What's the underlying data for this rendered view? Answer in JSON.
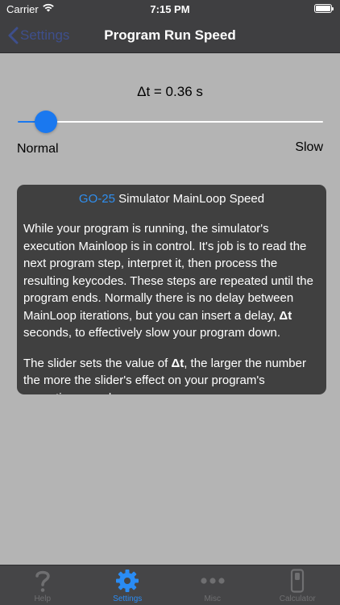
{
  "status_bar": {
    "carrier": "Carrier",
    "time": "7:15 PM"
  },
  "nav": {
    "back_label": "Settings",
    "title": "Program Run Speed"
  },
  "speed": {
    "delta_label": "Δt = 0.36 s",
    "slider_fraction": 0.06,
    "min_label": "Normal",
    "max_label": "Slow"
  },
  "info": {
    "title_accent": "GO-25",
    "title_rest": " Simulator MainLoop Speed",
    "para1_a": "While your program is running, the simulator's execution Mainloop is in control. It's job is to read the next program step, interpret it, then process the resulting keycodes. These steps are repeated until the program ends. Normally there is no delay between MainLoop iterations, but you can insert a delay, ",
    "para1_bold": "Δt",
    "para1_b": " seconds, to effectively slow your program down.",
    "para2_a": "The slider sets the value of ",
    "para2_bold": "Δt",
    "para2_b": ", the larger the number the more the slider's effect on your program's execution speed."
  },
  "tabs": [
    {
      "label": "Help",
      "icon": "question-icon",
      "active": false
    },
    {
      "label": "Settings",
      "icon": "gear-icon",
      "active": true
    },
    {
      "label": "Misc",
      "icon": "ellipsis-icon",
      "active": false
    },
    {
      "label": "Calculator",
      "icon": "calculator-icon",
      "active": false
    }
  ],
  "colors": {
    "accent": "#1a78ef",
    "nav_background": "#3f3f41",
    "content_background": "#b4b4b4",
    "info_box_background": "#404040"
  }
}
